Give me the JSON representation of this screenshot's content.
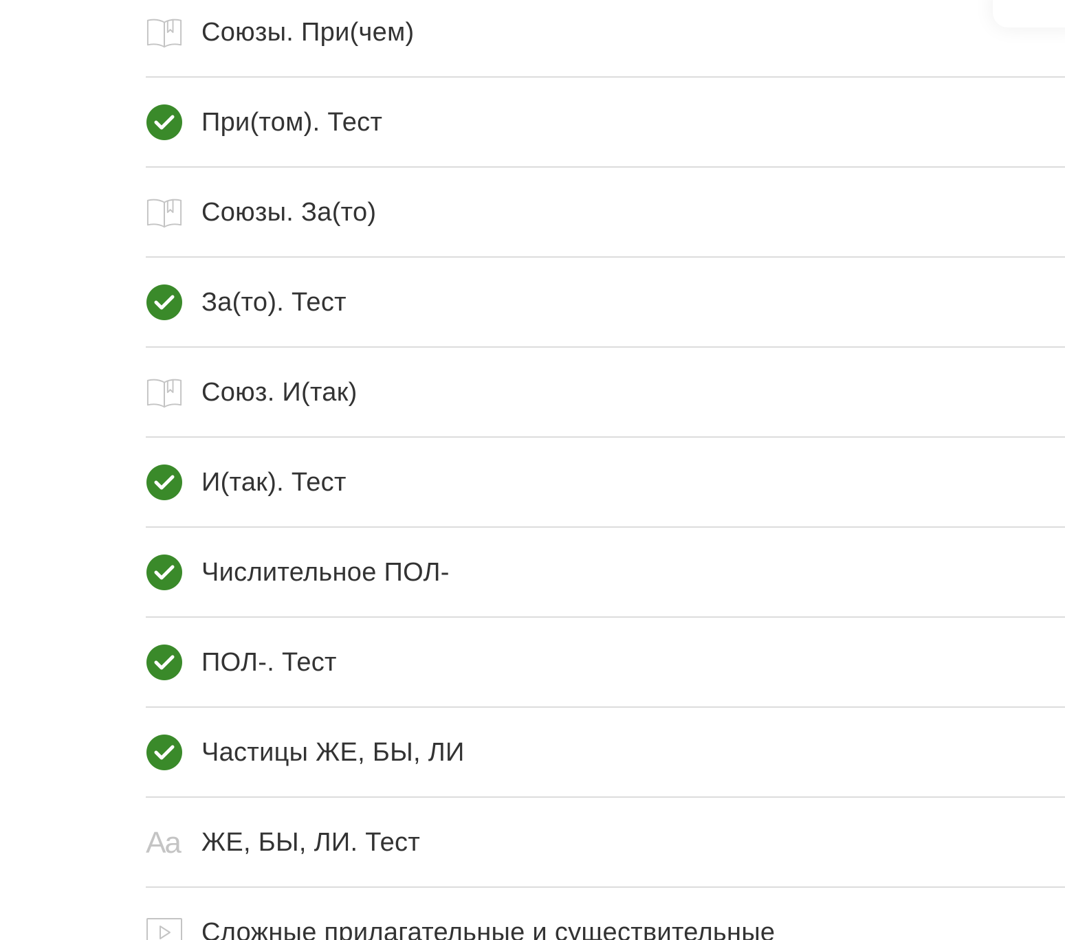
{
  "colors": {
    "check_green": "#3a8a2a",
    "icon_grey": "#c4c4c4",
    "text": "#333333",
    "divider": "#dcdcdc"
  },
  "lessons": [
    {
      "title": "Союзы. При(чем)",
      "icon": "book-icon"
    },
    {
      "title": "При(том). Тест",
      "icon": "check-circle-icon"
    },
    {
      "title": "Союзы. За(то)",
      "icon": "book-icon"
    },
    {
      "title": "За(то). Тест",
      "icon": "check-circle-icon"
    },
    {
      "title": "Союз. И(так)",
      "icon": "book-icon"
    },
    {
      "title": "И(так). Тест",
      "icon": "check-circle-icon"
    },
    {
      "title": "Числительное ПОЛ-",
      "icon": "check-circle-icon"
    },
    {
      "title": "ПОЛ-. Тест",
      "icon": "check-circle-icon"
    },
    {
      "title": "Частицы ЖЕ, БЫ, ЛИ",
      "icon": "check-circle-icon"
    },
    {
      "title": "ЖЕ, БЫ, ЛИ. Тест",
      "icon": "text-aa-icon",
      "icon_text": "Aa"
    },
    {
      "title": "Сложные прилагательные и существительные",
      "icon": "play-video-icon"
    }
  ]
}
